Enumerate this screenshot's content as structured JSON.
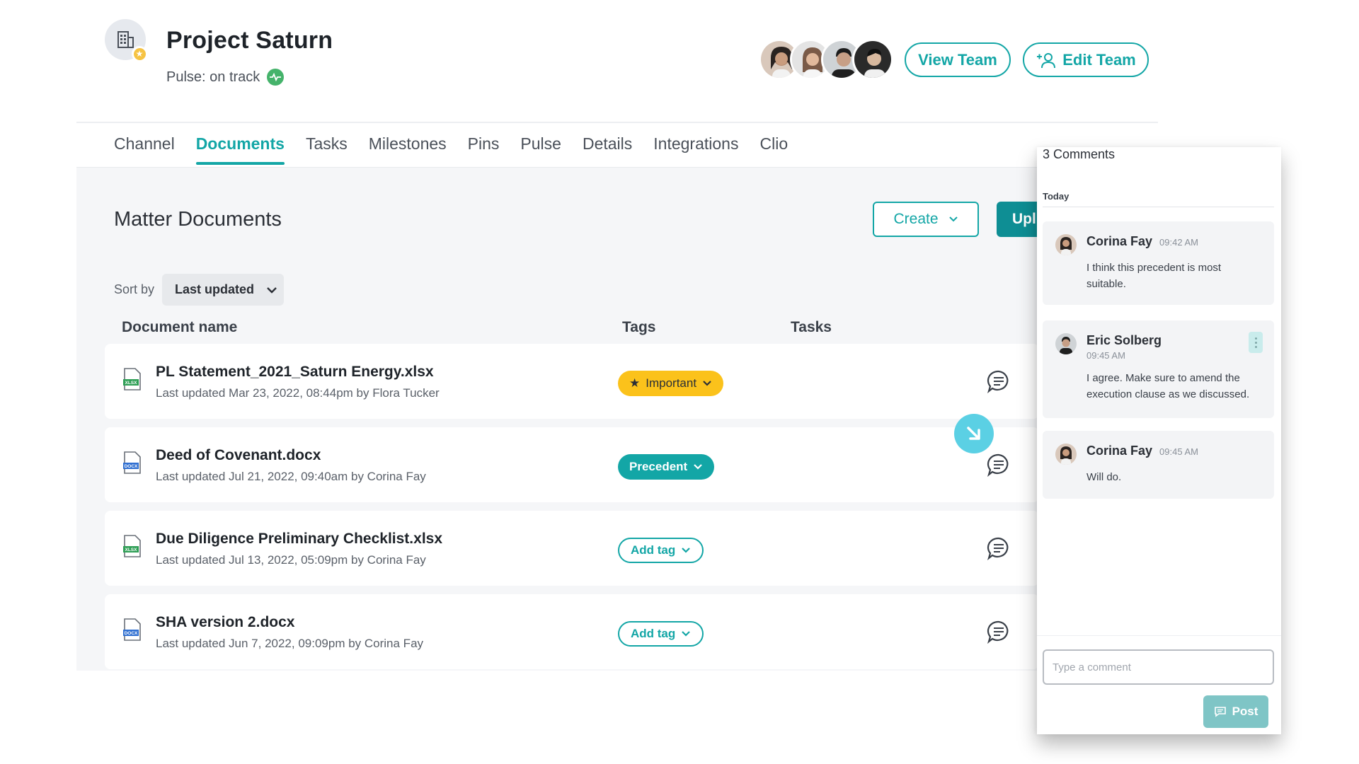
{
  "header": {
    "project_title": "Project Saturn",
    "pulse_label": "Pulse: on track",
    "view_team_label": "View Team",
    "edit_team_label": "Edit Team",
    "avatars": [
      "team-member-1",
      "team-member-2",
      "team-member-3",
      "team-member-4"
    ]
  },
  "tabs": [
    {
      "label": "Channel",
      "active": false
    },
    {
      "label": "Documents",
      "active": true
    },
    {
      "label": "Tasks",
      "active": false
    },
    {
      "label": "Milestones",
      "active": false
    },
    {
      "label": "Pins",
      "active": false
    },
    {
      "label": "Pulse",
      "active": false
    },
    {
      "label": "Details",
      "active": false
    },
    {
      "label": "Integrations",
      "active": false
    },
    {
      "label": "Clio",
      "active": false
    }
  ],
  "main": {
    "title": "Matter Documents",
    "create_label": "Create",
    "upload_label": "Upl",
    "sort_label": "Sort by",
    "sort_value": "Last updated",
    "columns": {
      "name": "Document name",
      "tags": "Tags",
      "tasks": "Tasks"
    },
    "documents": [
      {
        "name": "PL Statement_2021_Saturn Energy.xlsx",
        "meta": "Last updated Mar 23, 2022, 08:44pm by Flora Tucker",
        "type": "XLSX",
        "tag": "Important"
      },
      {
        "name": "Deed of Covenant.docx",
        "meta": "Last updated Jul 21, 2022, 09:40am by Corina Fay",
        "type": "DOCX",
        "tag": "Precedent"
      },
      {
        "name": "Due Diligence Preliminary Checklist.xlsx",
        "meta": "Last updated Jul 13, 2022, 05:09pm by Corina Fay",
        "type": "XLSX",
        "tag": "Add tag"
      },
      {
        "name": "SHA version 2.docx",
        "meta": "Last updated Jun 7, 2022, 09:09pm by Corina Fay",
        "type": "DOCX",
        "tag": "Add tag"
      }
    ]
  },
  "comments_panel": {
    "title": "3 Comments",
    "group_label": "Today",
    "comments": [
      {
        "author": "Corina Fay",
        "time": "09:42 AM",
        "text": "I think this precedent is most suitable."
      },
      {
        "author": "Eric Solberg",
        "time": "09:45 AM",
        "text": "I agree. Make sure to amend the execution clause as we discussed."
      },
      {
        "author": "Corina Fay",
        "time": "09:45 AM",
        "text": "Will do."
      }
    ],
    "input_placeholder": "Type a comment",
    "post_label": "Post"
  },
  "colors": {
    "accent": "#13a6a6",
    "important": "#fbc21b",
    "pulse_green": "#45b36b"
  }
}
